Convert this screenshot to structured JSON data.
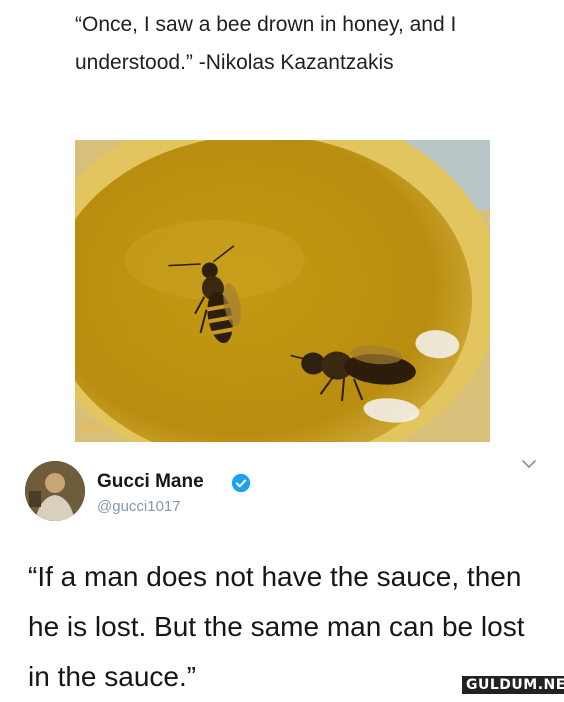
{
  "quote": {
    "text": "“Once, I saw a bee drown in honey, and I understood.” -Nikolas Kazantzakis"
  },
  "photo": {
    "description_icon": "bee-in-honey-photo",
    "corner_mark": "MM"
  },
  "tweet": {
    "author_name": "Gucci Mane",
    "handle": "@gucci1017",
    "verified": true,
    "text": "“If a man does not have the sauce, then he is lost. But the same man can be lost in the sauce.”"
  },
  "watermark": "GULDUM.NET",
  "colors": {
    "honey": "#c9a022",
    "verified_blue": "#1da1f2",
    "handle_gray": "#8899a6"
  }
}
